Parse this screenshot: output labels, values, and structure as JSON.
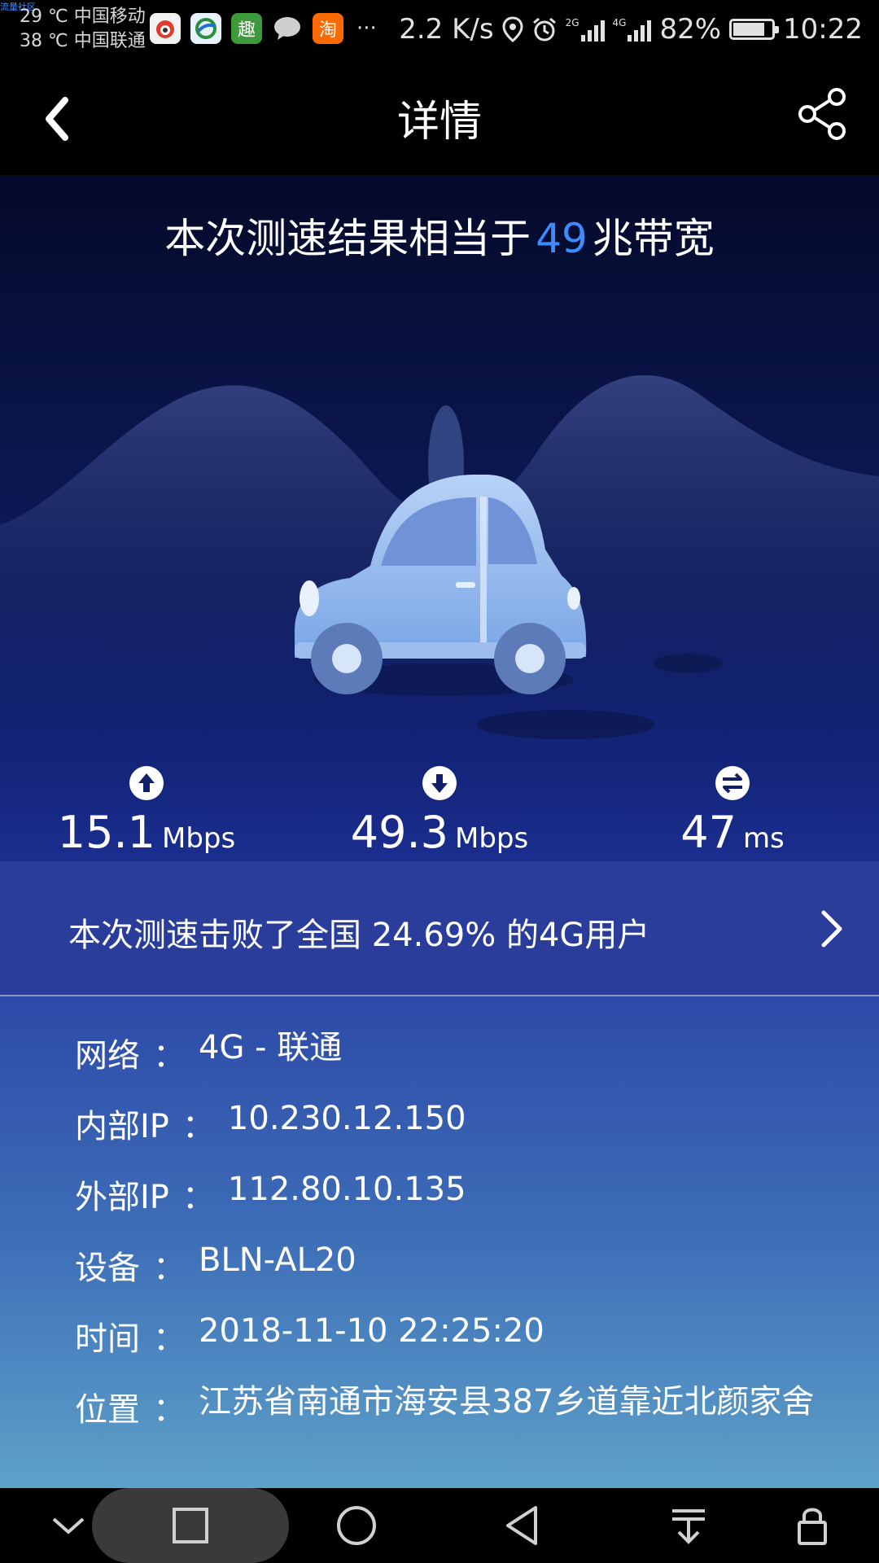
{
  "status_bar": {
    "corner_text": "流量社区",
    "line1": "29 ℃ 中国移动",
    "line2": "38 ℃ 中国联通",
    "app_icons": [
      "weibo-app-icon",
      "browser-app-icon",
      "qu-app-icon",
      "message-icon",
      "taobao-app-icon"
    ],
    "taobao_glyph": "淘",
    "qu_glyph": "趣",
    "overflow": "···",
    "net_speed": "2.2 K/s",
    "sim1_tag": "2G",
    "sim2_tag": "4G",
    "battery_pct": "82%",
    "battery_level": 0.82,
    "time": "10:22"
  },
  "header": {
    "title": "详情"
  },
  "hero": {
    "headline_prefix": "本次测速结果相当于",
    "headline_value": "49",
    "headline_suffix": "兆带宽"
  },
  "stats": {
    "upload": {
      "value": "15.1",
      "unit": "Mbps"
    },
    "download": {
      "value": "49.3",
      "unit": "Mbps"
    },
    "ping": {
      "value": "47",
      "unit": "ms"
    }
  },
  "beat": {
    "text": "本次测速击败了全国 24.69% 的4G用户"
  },
  "details": {
    "separator": "：",
    "rows": [
      {
        "label": "网络",
        "value": "4G - 联通"
      },
      {
        "label": "内部IP",
        "value": "10.230.12.150"
      },
      {
        "label": "外部IP",
        "value": "112.80.10.135"
      },
      {
        "label": "设备",
        "value": "BLN-AL20"
      },
      {
        "label": "时间",
        "value": "2018-11-10 22:25:20"
      },
      {
        "label": "位置",
        "value": "江苏省南通市海安县387乡道靠近北颜家舍"
      }
    ]
  },
  "colors": {
    "accent": "#3d8bff",
    "hero_bg": "#0b1750",
    "beat_bg": "#2a3d9a"
  }
}
